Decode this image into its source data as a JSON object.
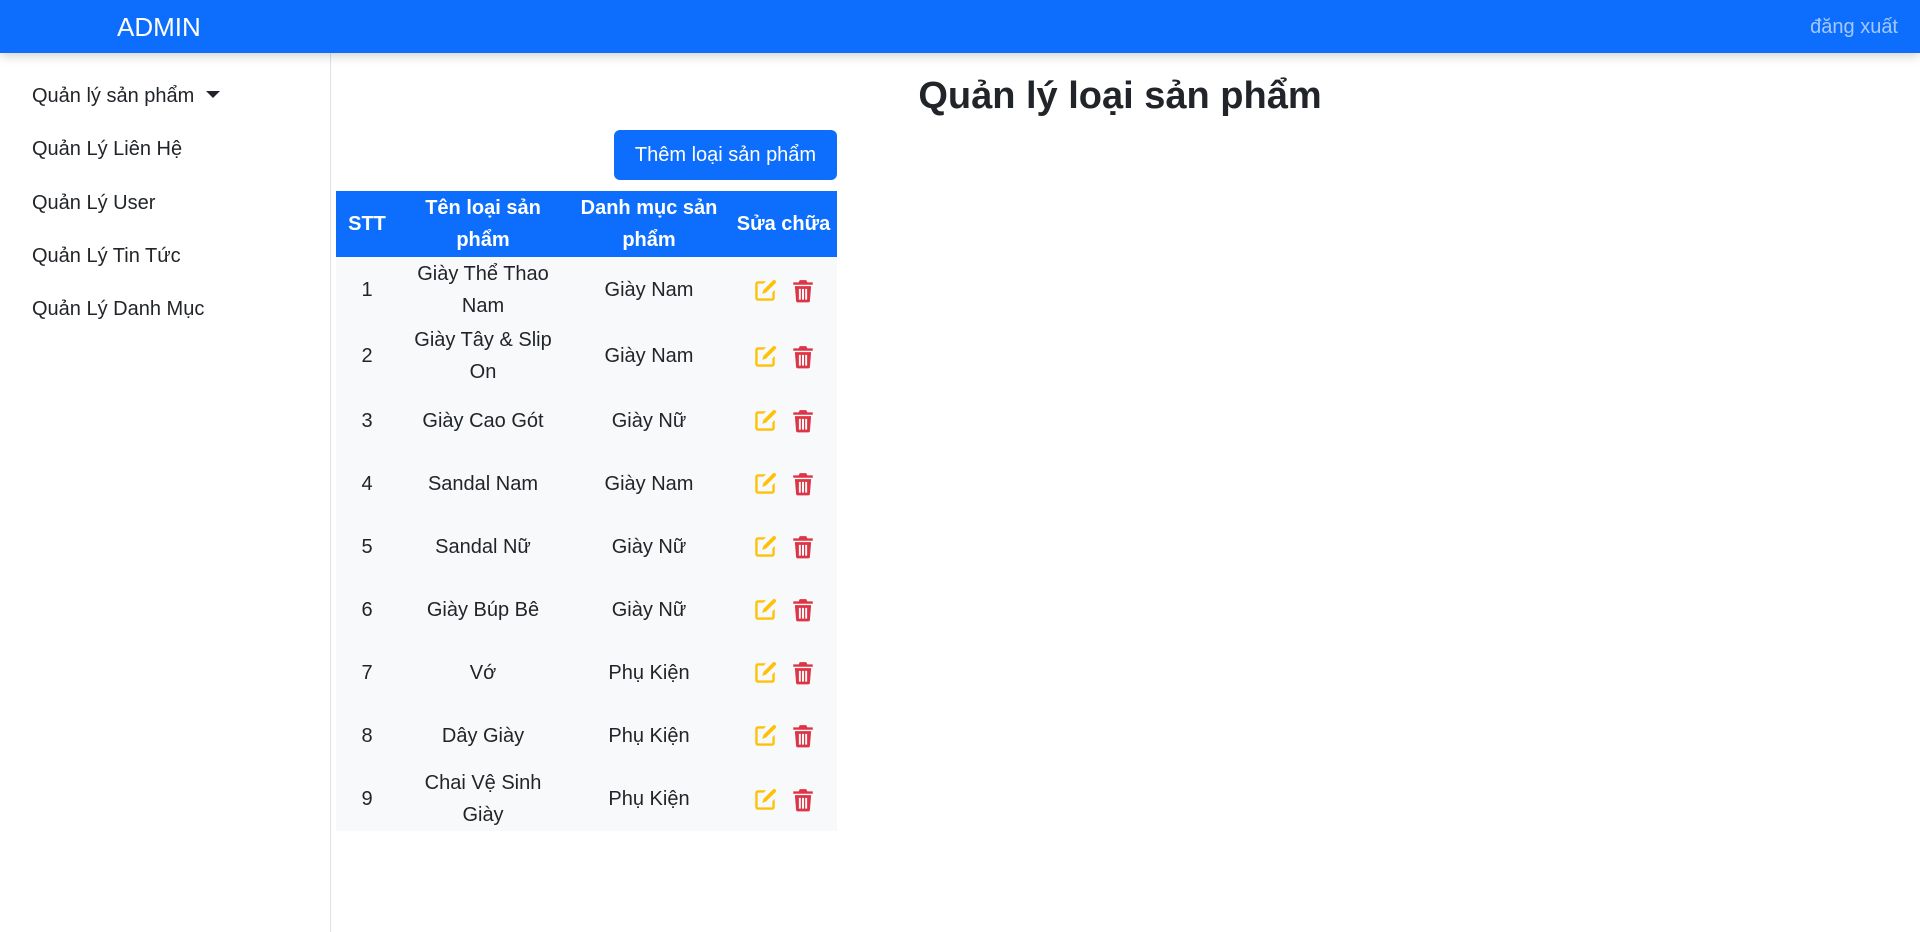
{
  "header": {
    "brand": "ADMIN",
    "logout_label": "đăng xuất"
  },
  "sidebar": {
    "items": [
      {
        "label": "Quản lý sản phẩm",
        "has_dropdown": true
      },
      {
        "label": "Quản Lý Liên Hệ"
      },
      {
        "label": "Quản Lý User"
      },
      {
        "label": "Quản Lý Tin Tức"
      },
      {
        "label": "Quản Lý Danh Mục"
      }
    ]
  },
  "main": {
    "title": "Quản lý loại sản phẩm",
    "add_button_label": "Thêm loại sản phẩm",
    "table": {
      "headers": [
        "STT",
        "Tên loại sản phẩm",
        "Danh mục sản phẩm",
        "Sửa chữa"
      ],
      "rows": [
        {
          "stt": "1",
          "name": "Giày Thể Thao Nam",
          "category": "Giày Nam"
        },
        {
          "stt": "2",
          "name": "Giày Tây & Slip On",
          "category": "Giày Nam"
        },
        {
          "stt": "3",
          "name": "Giày Cao Gót",
          "category": "Giày Nữ"
        },
        {
          "stt": "4",
          "name": "Sandal Nam",
          "category": "Giày Nam"
        },
        {
          "stt": "5",
          "name": "Sandal Nữ",
          "category": "Giày Nữ"
        },
        {
          "stt": "6",
          "name": "Giày Búp Bê",
          "category": "Giày Nữ"
        },
        {
          "stt": "7",
          "name": "Vớ",
          "category": "Phụ Kiện"
        },
        {
          "stt": "8",
          "name": "Dây Giày",
          "category": "Phụ Kiện"
        },
        {
          "stt": "9",
          "name": "Chai Vệ Sinh Giày",
          "category": "Phụ Kiện"
        }
      ]
    },
    "icons": {
      "edit": "edit-icon",
      "delete": "trash-icon"
    }
  },
  "colors": {
    "primary": "#0d6efd",
    "edit": "#ffc107",
    "delete": "#dc3545",
    "row_bg": "#f8f9fa"
  }
}
